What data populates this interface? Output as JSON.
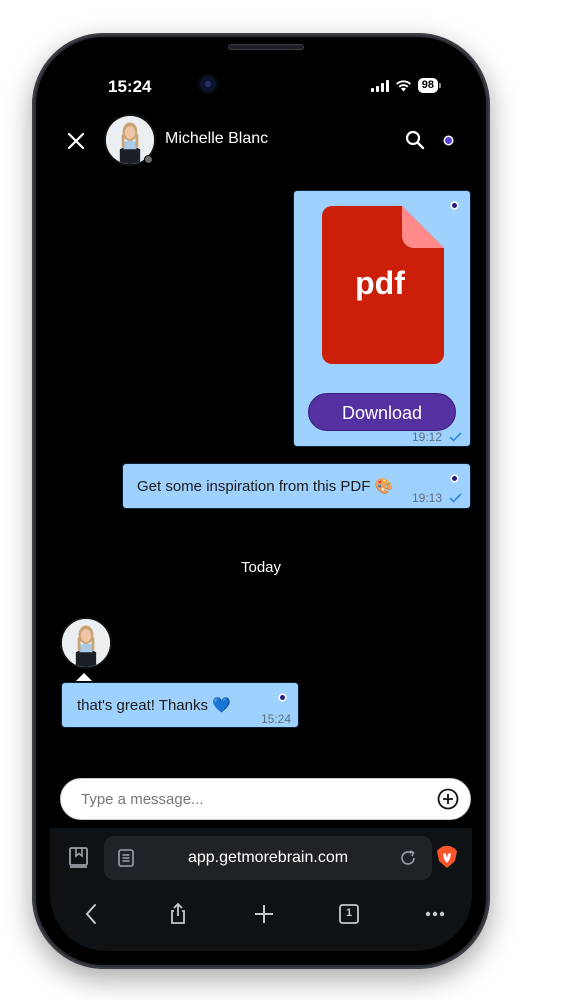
{
  "status_bar": {
    "time": "15:24",
    "battery": "98"
  },
  "header": {
    "contact_name": "Michelle Blanc"
  },
  "messages": [
    {
      "type": "file",
      "file_label": "pdf",
      "button_label": "Download",
      "time": "19:12",
      "direction": "outgoing",
      "read": true
    },
    {
      "type": "text",
      "text": "Get some inspiration from this PDF 🎨",
      "time": "19:13",
      "direction": "outgoing",
      "read": true
    },
    {
      "type": "separator",
      "text": "Today"
    },
    {
      "type": "text",
      "text": "that's great! Thanks 💙",
      "time": "15:24",
      "direction": "incoming"
    }
  ],
  "composer": {
    "placeholder": "Type a message..."
  },
  "browser": {
    "url": "app.getmorebrain.com",
    "tab_count": "1"
  },
  "colors": {
    "bubble": "#9fd1ff",
    "download": "#5430a0",
    "pdf_red": "#cc1f0a",
    "pdf_fold": "#ff8a8a",
    "accent_dot": "#5a3fd6"
  }
}
